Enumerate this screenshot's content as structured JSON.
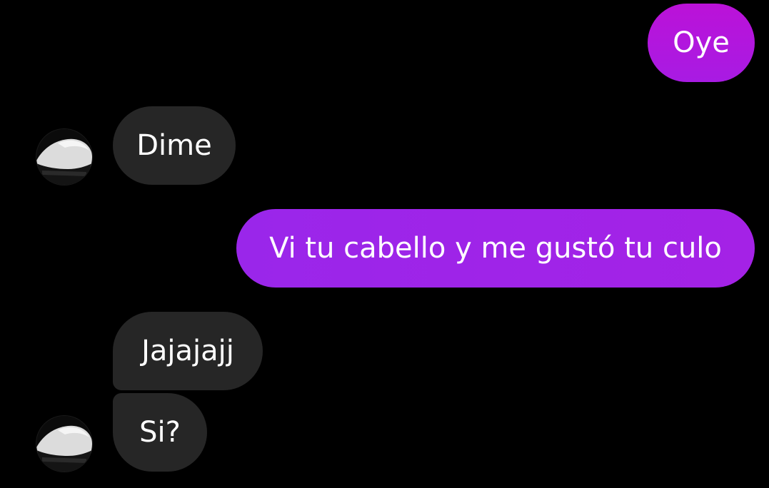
{
  "conversation": {
    "messages": [
      {
        "sender": "me",
        "text": "Oye"
      },
      {
        "sender": "them",
        "text": "Dime"
      },
      {
        "sender": "me",
        "text": "Vi tu cabello y me gustó tu culo"
      },
      {
        "sender": "them",
        "text": "Jajajajj"
      },
      {
        "sender": "them",
        "text": "Si?"
      }
    ]
  },
  "avatar": {
    "icon": "profile-photo-avatar"
  },
  "colors": {
    "background": "#000000",
    "outgoing_bubble": "#a222e6",
    "incoming_bubble": "#262626",
    "text": "#ffffff"
  }
}
